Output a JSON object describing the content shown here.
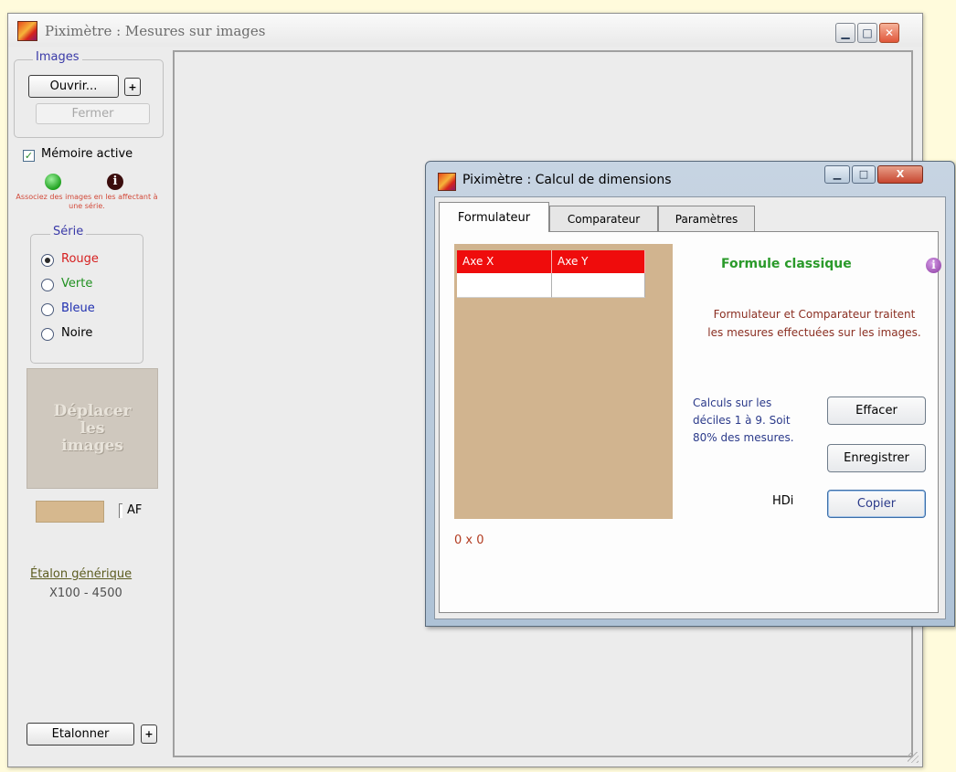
{
  "main_window": {
    "title": "Piximètre : Mesures sur images",
    "minimize_glyph": "▁",
    "maximize_glyph": "□",
    "close_glyph": "✕"
  },
  "left_panel": {
    "images_group": {
      "legend": "Images",
      "open_label": "Ouvrir...",
      "plus_label": "+",
      "close_label": "Fermer"
    },
    "memory": {
      "checkbox_label": "Mémoire active",
      "checked": true,
      "info_glyph": "i",
      "hint": "Associez des images en les affectant à une série."
    },
    "series_group": {
      "legend": "Série",
      "options": [
        {
          "label": "Rouge",
          "color": "#d62020",
          "checked": true
        },
        {
          "label": "Verte",
          "color": "#209020",
          "checked": false
        },
        {
          "label": "Bleue",
          "color": "#2030b0",
          "checked": false
        },
        {
          "label": "Noire",
          "color": "#000000",
          "checked": false
        }
      ]
    },
    "drag_zone_text": "Déplacer\nles\nimages",
    "af_label": "AF",
    "standard_link": "Étalon générique",
    "standard_range": "X100 - 4500",
    "calibrate_label": "Etalonner",
    "calibrate_plus": "+"
  },
  "dialog": {
    "title": "Piximètre : Calcul de dimensions",
    "minimize_glyph": "▁",
    "maximize_glyph": "□",
    "close_glyph": "X",
    "tabs": [
      {
        "label": "Formulateur",
        "active": true
      },
      {
        "label": "Comparateur",
        "active": false
      },
      {
        "label": "Paramètres",
        "active": false
      }
    ],
    "grid_headers": [
      "Axe X",
      "Axe Y"
    ],
    "dimensions": "0 x 0",
    "formula_title": "Formule classique",
    "info_glyph": "i",
    "description": "Formulateur et Comparateur traitent les mesures effectuées sur les images.",
    "calc_note": "Calculs sur les déciles 1 à 9. Soit 80% des mesures.",
    "hdi_label": "HDi",
    "buttons": {
      "clear": "Effacer",
      "save": "Enregistrer",
      "copy": "Copier"
    }
  }
}
